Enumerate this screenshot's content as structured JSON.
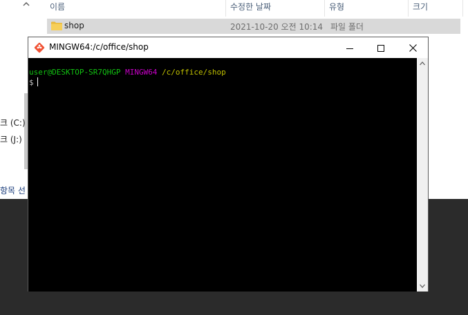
{
  "explorer": {
    "columns": {
      "name": "이름",
      "modified": "수정한 날짜",
      "type": "유형",
      "size": "크기"
    },
    "rows": [
      {
        "name": "shop",
        "modified": "2021-10-20 오전 10:14",
        "type": "파일 폴더"
      }
    ],
    "nav_items": [
      "크 (C:)",
      "크 (J:)"
    ],
    "status": "항목 선"
  },
  "terminal": {
    "title": "MINGW64:/c/office/shop",
    "prompt_user": "user@DESKTOP-SR7QHGP",
    "prompt_system": "MINGW64",
    "prompt_path": "/c/office/shop",
    "prompt_symbol": "$"
  },
  "colors": {
    "user": "#12c312",
    "system": "#c800c8",
    "path": "#c0c000",
    "terminal_bg": "#000000",
    "selected_row": "#d9d9d9"
  },
  "icons": [
    "git-bash-icon",
    "minimize-icon",
    "maximize-icon",
    "close-icon",
    "folder-icon",
    "scroll-up-icon",
    "scroll-down-icon"
  ]
}
